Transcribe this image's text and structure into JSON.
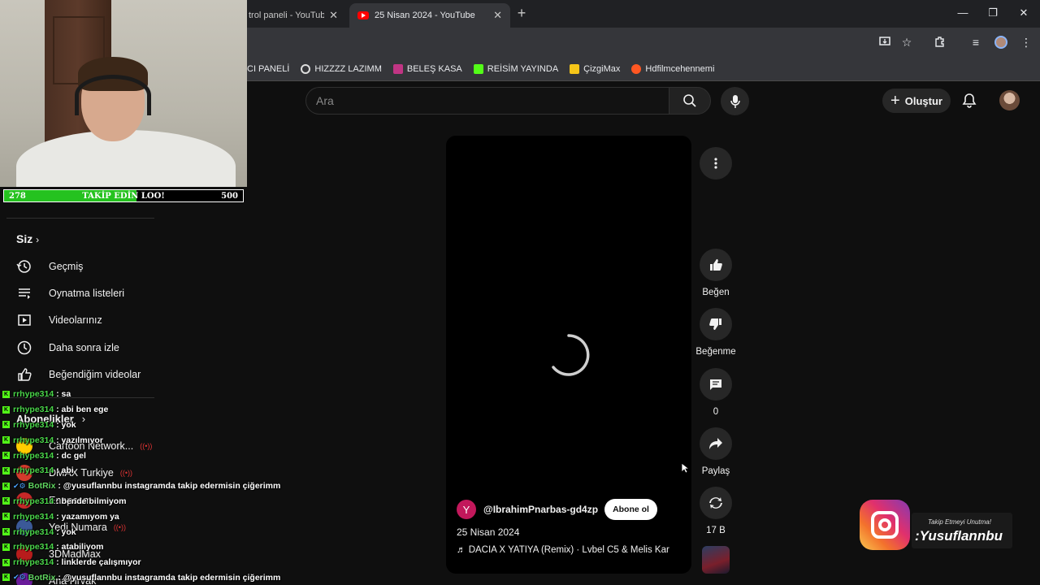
{
  "browser": {
    "tabs": [
      {
        "title": "trol paneli - YouTube",
        "active": false
      },
      {
        "title": "25 Nisan 2024 - YouTube",
        "active": true
      }
    ],
    "window_controls": {
      "minimize": "—",
      "restore": "❐",
      "close": "✕"
    },
    "bookmarks": [
      {
        "label": "CI PANELİ",
        "icon_color": "#888888"
      },
      {
        "label": "HIZZZZ LAZIMM",
        "icon_color": "#dddddd"
      },
      {
        "label": "BELEŞ KASA",
        "icon_color": "#c13584"
      },
      {
        "label": "REİSİM YAYINDA",
        "icon_color": "#53fc18"
      },
      {
        "label": "ÇizgiMax",
        "icon_color": "#f5c518"
      },
      {
        "label": "Hdfilmcehennemi",
        "icon_color": "#ff5722"
      }
    ]
  },
  "youtube": {
    "search_placeholder": "Ara",
    "create_label": "Oluştur",
    "short": {
      "channel_initial": "Y",
      "channel_name": "@IbrahimPnarbas-gd4zp",
      "subscribe_label": "Abone ol",
      "title": "25 Nisan 2024",
      "music": "DACIA X YATIYA (Remix) · Lvbel C5 & Melis Kar"
    },
    "actions": {
      "like": "Beğen",
      "dislike": "Beğenme",
      "comments": "0",
      "share": "Paylaş",
      "remix": "17 B"
    },
    "sidebar": {
      "you_heading": "Siz",
      "items": [
        {
          "label": "Geçmiş",
          "icon": "history-icon"
        },
        {
          "label": "Oynatma listeleri",
          "icon": "playlist-icon"
        },
        {
          "label": "Videolarınız",
          "icon": "video-icon"
        },
        {
          "label": "Daha sonra izle",
          "icon": "clock-icon"
        },
        {
          "label": "Beğendiğim videolar",
          "icon": "like-icon"
        }
      ],
      "subscriptions_heading": "Abonelikler",
      "subscriptions": [
        {
          "label": "Cartoon Network...",
          "color": "#ffcc00"
        },
        {
          "label": "DMAX Turkiye",
          "color": "#d33b2c"
        },
        {
          "label": "Enapcam",
          "color": "#c62828"
        },
        {
          "label": "Yedi Numara",
          "color": "#3b5998"
        },
        {
          "label": "3DMadMax",
          "color": "#b71c1c"
        },
        {
          "label": "Ana Hrvak",
          "color": "#6a1b9a"
        }
      ]
    }
  },
  "stream_overlay": {
    "progress": {
      "current": "278",
      "goal": "500",
      "label": "TAKİP EDİN LOO!",
      "fraction": 0.556
    },
    "chat": [
      {
        "user": "rrhype314",
        "message": "sa",
        "bot": false
      },
      {
        "user": "rrhype314",
        "message": "abi ben ege",
        "bot": false
      },
      {
        "user": "rrhype314",
        "message": "yok",
        "bot": false
      },
      {
        "user": "rrhype314",
        "message": "yazılmıyor",
        "bot": false
      },
      {
        "user": "rrhype314",
        "message": "dc gel",
        "bot": false
      },
      {
        "user": "rrhype314",
        "message": "abi",
        "bot": false
      },
      {
        "user": "BotRix",
        "message": "@yusuflannbu instagramda takip edermisin çiğerimm",
        "bot": true
      },
      {
        "user": "rrhype314",
        "message": "bende bilmiyom",
        "bot": false
      },
      {
        "user": "rrhype314",
        "message": "yazamıyom ya",
        "bot": false
      },
      {
        "user": "rrhype314",
        "message": "yok",
        "bot": false
      },
      {
        "user": "rrhype314",
        "message": "atabiliyom",
        "bot": false
      },
      {
        "user": "rrhype314",
        "message": "linklerde çalışmıyor",
        "bot": false
      },
      {
        "user": "BotRix",
        "message": "@yusuflannbu instagramda takip edermisin çiğerimm",
        "bot": true
      }
    ],
    "instagram": {
      "note": "Takip Etmeyi Unutma!",
      "handle": ":Yusuflannbu"
    }
  }
}
